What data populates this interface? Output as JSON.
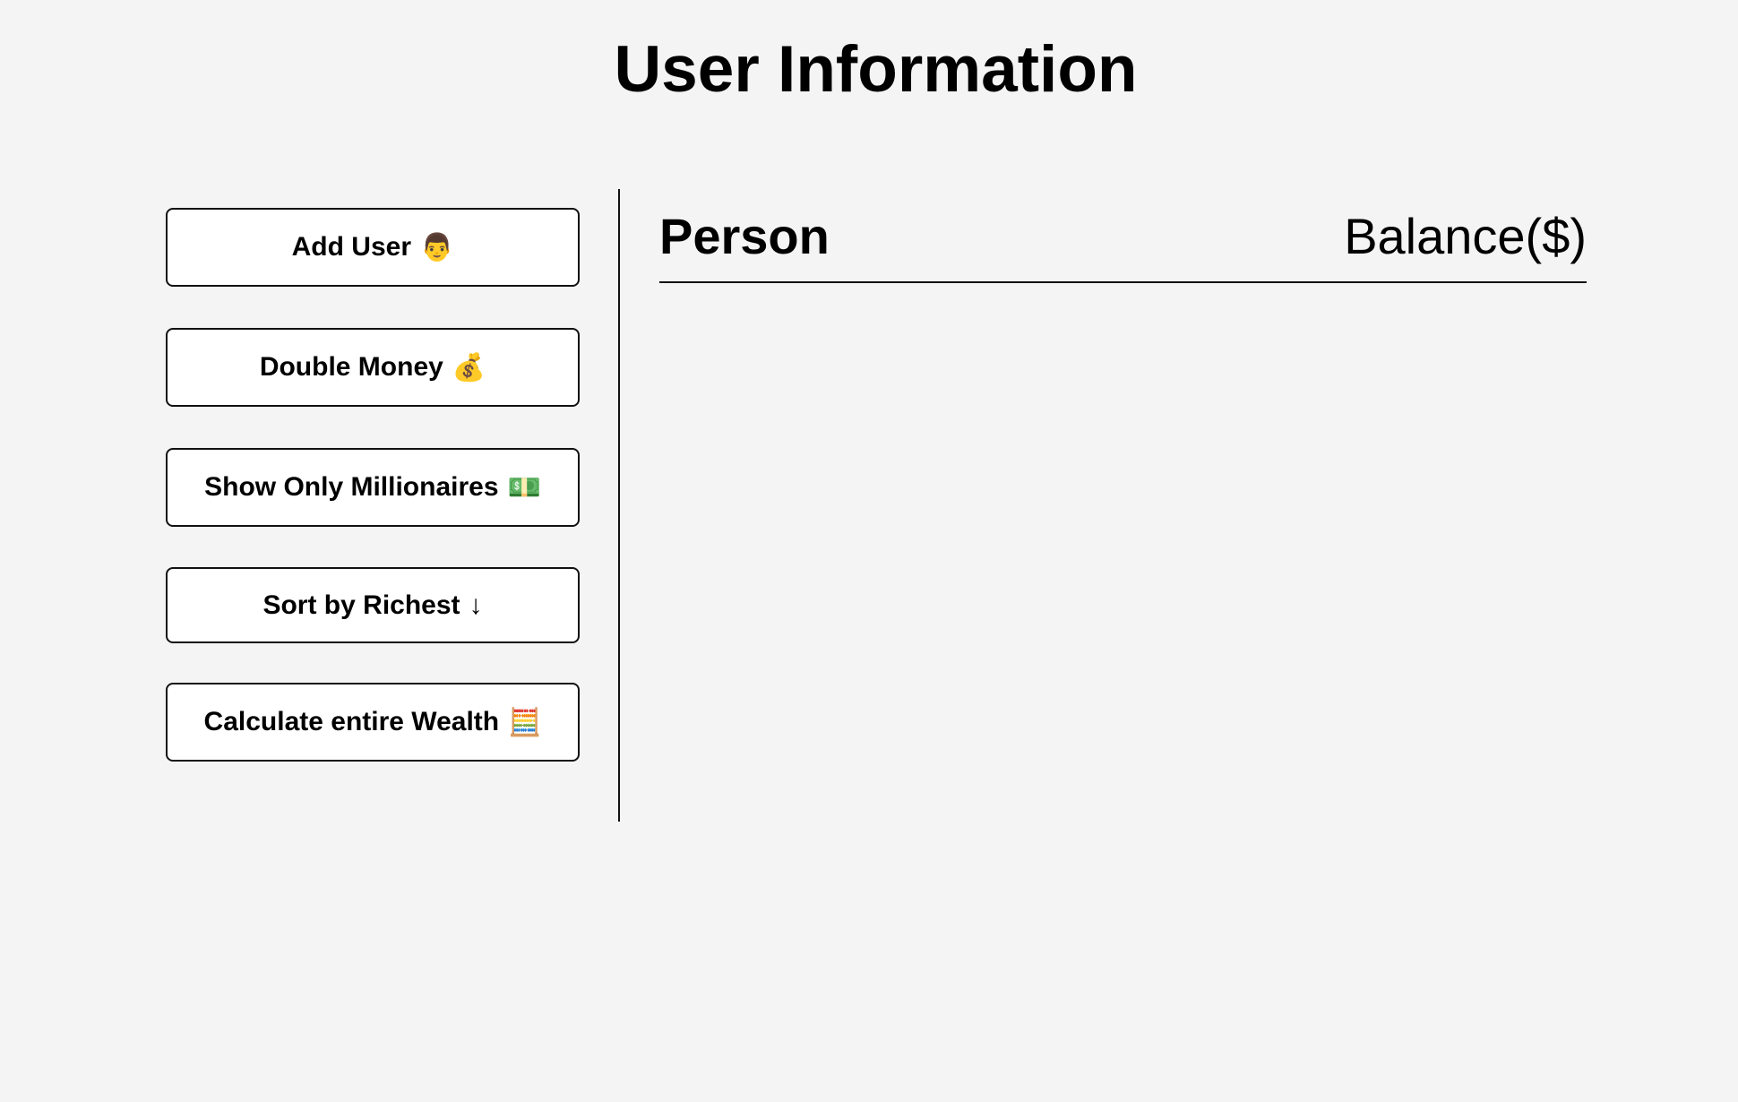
{
  "header": {
    "title": "User Information"
  },
  "sidebar": {
    "buttons": [
      {
        "label": "Add User",
        "icon": "👨"
      },
      {
        "label": "Double Money",
        "icon": "💰"
      },
      {
        "label": "Show Only Millionaires",
        "icon": "💵"
      },
      {
        "label": "Sort by Richest",
        "icon": "↓"
      },
      {
        "label": "Calculate entire Wealth",
        "icon": "🧮"
      }
    ]
  },
  "main": {
    "columns": {
      "person": "Person",
      "balance": "Balance($)"
    },
    "rows": []
  }
}
